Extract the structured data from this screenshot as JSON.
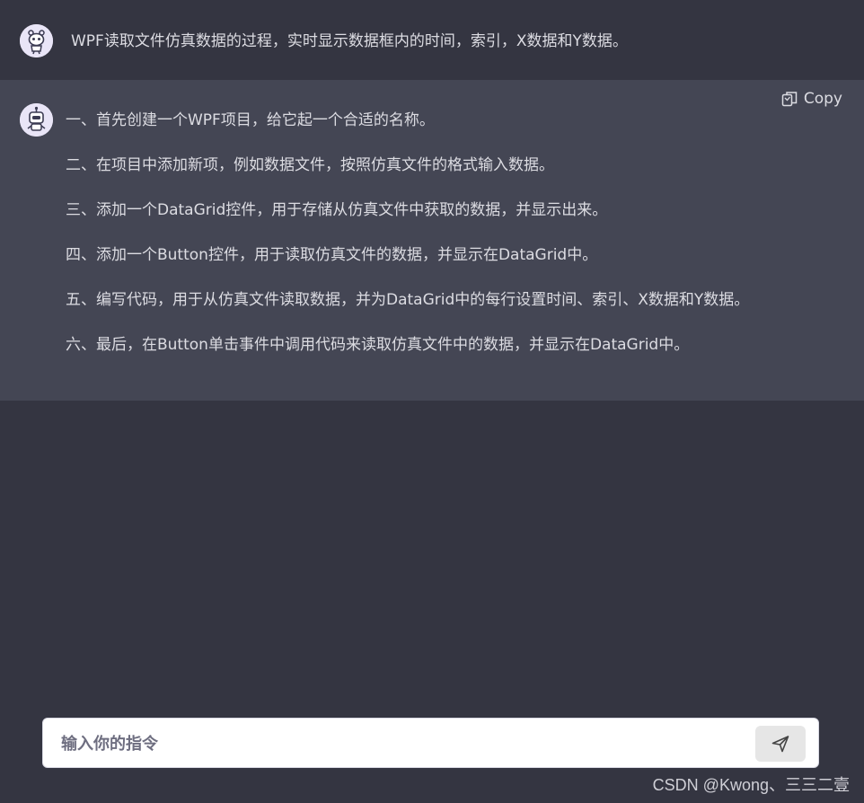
{
  "user_message": {
    "avatar_icon": "robot-mascot-icon",
    "text": "WPF读取文件仿真数据的过程，实时显示数据框内的时间，索引，X数据和Y数据。"
  },
  "bot_message": {
    "avatar_icon": "robot-icon",
    "copy_label": "Copy",
    "steps": [
      "一、首先创建一个WPF项目，给它起一个合适的名称。",
      "二、在项目中添加新项，例如数据文件，按照仿真文件的格式输入数据。",
      "三、添加一个DataGrid控件，用于存储从仿真文件中获取的数据，并显示出来。",
      "四、添加一个Button控件，用于读取仿真文件的数据，并显示在DataGrid中。",
      "五、编写代码，用于从仿真文件读取数据，并为DataGrid中的每行设置时间、索引、X数据和Y数据。",
      "六、最后，在Button单击事件中调用代码来读取仿真文件中的数据，并显示在DataGrid中。"
    ]
  },
  "composer": {
    "placeholder": "输入你的指令",
    "value": "",
    "send_icon": "send-icon"
  },
  "watermark": "CSDN @Kwong、三三二壹",
  "colors": {
    "background": "#343541",
    "bot_background": "#444654",
    "avatar_background": "#e9e5f7"
  }
}
